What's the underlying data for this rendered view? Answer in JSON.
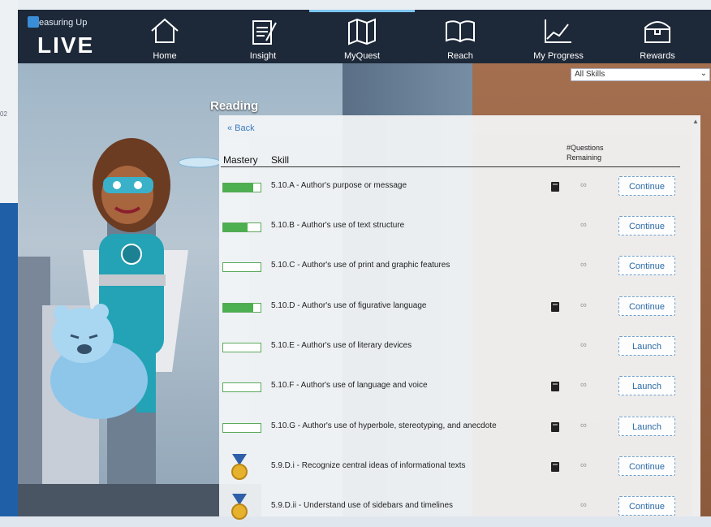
{
  "app": {
    "logo_small": "easuring Up",
    "logo_big": "LIVE"
  },
  "nav": [
    {
      "label": "Home",
      "icon": "house-icon"
    },
    {
      "label": "Insight",
      "icon": "clipboard-icon"
    },
    {
      "label": "MyQuest",
      "icon": "map-icon"
    },
    {
      "label": "Reach",
      "icon": "book-icon"
    },
    {
      "label": "My Progress",
      "icon": "line-chart-icon"
    },
    {
      "label": "Rewards",
      "icon": "treasure-chest-icon"
    }
  ],
  "filter": {
    "selected": "All Skills"
  },
  "subject": "Reading",
  "back_label": "« Back",
  "left_strip_number": "02",
  "table": {
    "col_mastery": "Mastery",
    "col_skill": "Skill",
    "col_questions": "#Questions\nRemaining"
  },
  "rows": [
    {
      "type": "bar",
      "mastery": 0.8,
      "skill": "5.10.A - Author's purpose or message",
      "book": true,
      "remaining": "∞",
      "action": "Continue"
    },
    {
      "type": "bar",
      "mastery": 0.65,
      "skill": "5.10.B - Author's use of text structure",
      "book": false,
      "remaining": "∞",
      "action": "Continue"
    },
    {
      "type": "bar",
      "mastery": 0.0,
      "skill": "5.10.C - Author's use of print and graphic features",
      "book": false,
      "remaining": "∞",
      "action": "Continue"
    },
    {
      "type": "bar",
      "mastery": 0.8,
      "skill": "5.10.D - Author's use of figurative language",
      "book": true,
      "remaining": "∞",
      "action": "Continue"
    },
    {
      "type": "bar",
      "mastery": 0.0,
      "skill": "5.10.E - Author's use of literary devices",
      "book": false,
      "remaining": "∞",
      "action": "Launch"
    },
    {
      "type": "bar",
      "mastery": 0.0,
      "skill": "5.10.F - Author's use of language and voice",
      "book": true,
      "remaining": "∞",
      "action": "Launch"
    },
    {
      "type": "bar",
      "mastery": 0.0,
      "skill": "5.10.G - Author's use of hyperbole, stereotyping, and anecdote",
      "book": true,
      "remaining": "∞",
      "action": "Launch"
    },
    {
      "type": "medal",
      "mastery": 1.0,
      "skill": "5.9.D.i - Recognize central ideas of informational texts",
      "book": true,
      "remaining": "∞",
      "action": "Continue"
    },
    {
      "type": "medal",
      "mastery": 1.0,
      "skill": "5.9.D.ii - Understand use of sidebars and timelines",
      "book": false,
      "remaining": "∞",
      "action": "Continue"
    }
  ]
}
